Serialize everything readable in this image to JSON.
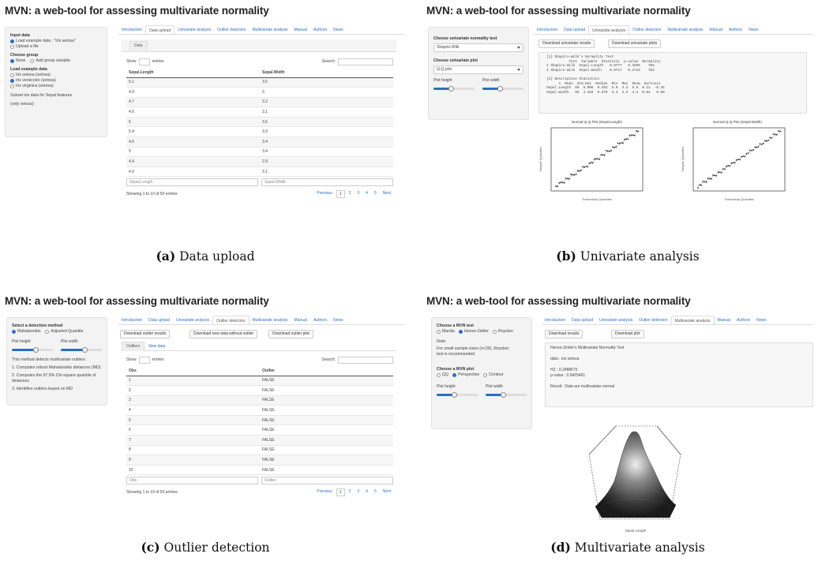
{
  "app_title": "MVN: a web-tool for assessing multivariate normality",
  "nav_tabs": [
    "Introduction",
    "Data upload",
    "Univariate analysis",
    "Outlier detection",
    "Multivariate analysis",
    "Manual",
    "Authors",
    "News"
  ],
  "panel_a": {
    "caption_letter": "(a)",
    "caption_text": " Data upload",
    "sidebar": {
      "input_label": "Input data",
      "input_opts": [
        "Load example data : \"Iris setosa\"",
        "Upload a file"
      ],
      "group_label": "Choose group",
      "group_opts": [
        "None",
        "Add group variable"
      ],
      "choose_label": "Load example data",
      "choose_select": "Iris setosa (setosa)",
      "choose_opts": [
        "Iris versicolor (setosa)",
        "Iris virginica (setosa)"
      ],
      "note1": "Subset iris data for Sepal features",
      "note2": "(only setosa)"
    },
    "subtab": "Data",
    "show_label": "Show",
    "show_suffix": "entries",
    "search_label": "Search:",
    "columns": [
      "Sepal.Length",
      "Sepal.Width"
    ],
    "rows": [
      [
        "5.1",
        "3.5"
      ],
      [
        "4.9",
        "3"
      ],
      [
        "4.7",
        "3.2"
      ],
      [
        "4.6",
        "3.1"
      ],
      [
        "5",
        "3.6"
      ],
      [
        "5.4",
        "3.9"
      ],
      [
        "4.6",
        "3.4"
      ],
      [
        "5",
        "3.4"
      ],
      [
        "4.4",
        "2.9"
      ],
      [
        "4.9",
        "3.1"
      ]
    ],
    "footer_inputs": [
      "Sepal.Length",
      "Sepal.Width"
    ],
    "info": "Showing 1 to 10 of 50 entries",
    "pager": [
      "Previous",
      "1",
      "2",
      "3",
      "4",
      "5",
      "Next"
    ]
  },
  "panel_b": {
    "caption_letter": "(b)",
    "caption_text": " Univariate analysis",
    "sidebar": {
      "test_label": "Choose univariate normality test",
      "test_value": "Shapiro-Wilk",
      "plot_label": "Choose univariate plot",
      "plot_value": "Q-Q plot",
      "height_label": "Plot height",
      "width_label": "Plot width"
    },
    "buttons": [
      "Download univariate results",
      "Download univariate plots"
    ],
    "console": "  [1] Shapiro-Wilk's Normality Test\n             Test  Variable  Statistic  p-value  Normality\n  1 Shapiro-Wilk  Sepal.Length   0.9777   0.4595    YES\n  2 Shapiro-Wilk  Sepal.Width    0.9717   0.2715    YES\n\n  [2] Descriptive Statistics\n        n  Mean  Std.Dev  Median  Min  Max  Skew  Kurtosis\n  Sepal.Length  50  5.006  0.352  5.0  4.3  5.8  0.11  -0.45\n  Sepal.Width   50  3.428  0.379  3.4  2.3  4.4  0.04   0.60",
    "plot_titles": [
      "Normal Q-Q Plot (Sepal.Length)",
      "Normal Q-Q Plot (Sepal.Width)"
    ],
    "plot_xlabel": "Theoretical Quantiles",
    "plot_ylabel": "Sample Quantiles"
  },
  "panel_c": {
    "caption_letter": "(c)",
    "caption_text": " Outlier detection",
    "sidebar": {
      "method_label": "Select a detection method",
      "method_opts": [
        "Mahalanobis",
        "Adjusted Quantile"
      ],
      "height_label": "Plot height",
      "width_label": "Plot width",
      "text1": "This method detects multivariate outliers",
      "text2": "1. Computes robust Mahalanobis distances (MD)",
      "text3": "2. Computes the 97.5% Chi-square quantile of distances",
      "text4": "3. Identifies outliers based on MD"
    },
    "buttons": [
      "Download outlier results",
      "Download new data without outlier",
      "Download outlier plot"
    ],
    "subtabs": [
      "Outliers",
      "New data"
    ],
    "show_label": "Show",
    "show_suffix": "entries",
    "search_label": "Search:",
    "columns": [
      "Obs",
      "Outlier"
    ],
    "rows": [
      [
        "1",
        "FALSE"
      ],
      [
        "2",
        "FALSE"
      ],
      [
        "3",
        "FALSE"
      ],
      [
        "4",
        "FALSE"
      ],
      [
        "5",
        "FALSE"
      ],
      [
        "6",
        "FALSE"
      ],
      [
        "7",
        "FALSE"
      ],
      [
        "8",
        "FALSE"
      ],
      [
        "9",
        "FALSE"
      ],
      [
        "10",
        "FALSE"
      ]
    ],
    "footer_inputs": [
      "Obs",
      "Outlier"
    ],
    "info": "Showing 1 to 10 of 50 entries",
    "pager": [
      "Previous",
      "1",
      "2",
      "3",
      "4",
      "5",
      "Next"
    ]
  },
  "panel_d": {
    "caption_letter": "(d)",
    "caption_text": " Multivariate analysis",
    "sidebar": {
      "test_label": "Choose a MVN test",
      "test_opts": [
        "Mardia",
        "Henze-Zirkler",
        "Royston"
      ],
      "info1": "Note:",
      "info2": "For small sample sizes (n<20), Royston",
      "info3": "test is recommended",
      "plot_label": "Choose a MVN plot",
      "plot_opts": [
        "QQ",
        "Perspective",
        "Contour"
      ],
      "height_label": "Plot height",
      "width_label": "Plot width"
    },
    "buttons": [
      "Download results",
      "Download plot"
    ],
    "result_lines": [
      "Henze-Zirkler's Multivariate Normality Test",
      "data : iris setosa",
      "HZ      : 0.2488675",
      "p-value : 0.9425461",
      "Result : Data are multivariate normal"
    ],
    "plot_xlabel": "Sepal.Length"
  }
}
